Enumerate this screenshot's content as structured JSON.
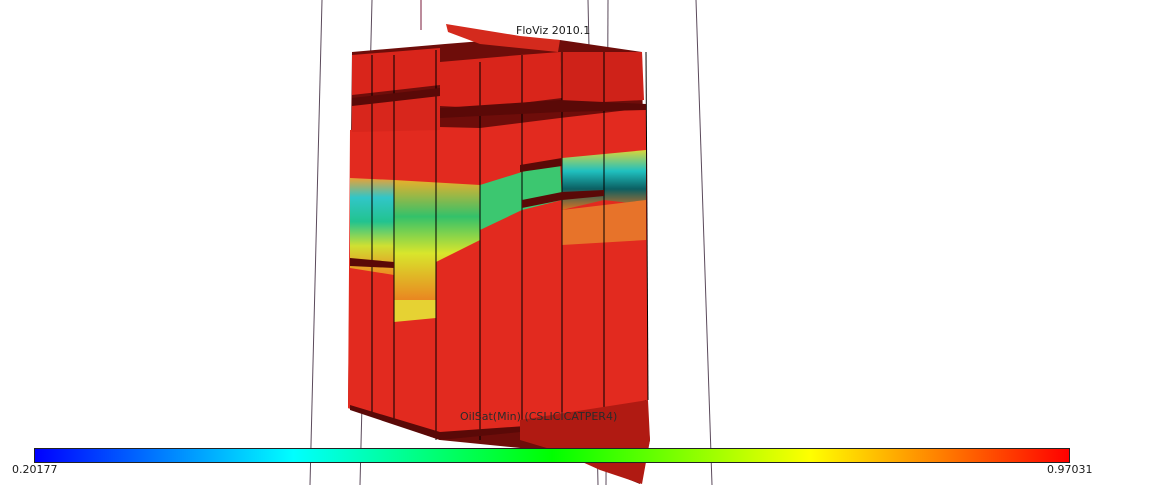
{
  "app_title": "FloViz 2010.1",
  "legend": {
    "title": "OilSat(Min) (CSLICICATPER4)",
    "min_label": "0.20177",
    "max_label": "0.97031",
    "colormap": [
      "#0000ff",
      "#00ffff",
      "#00ff00",
      "#ffff00",
      "#ff0000"
    ]
  },
  "colors": {
    "mesh_fill": "#e22a1f",
    "mesh_shadow": "#6e0d0a",
    "grid_line": "#000000"
  }
}
